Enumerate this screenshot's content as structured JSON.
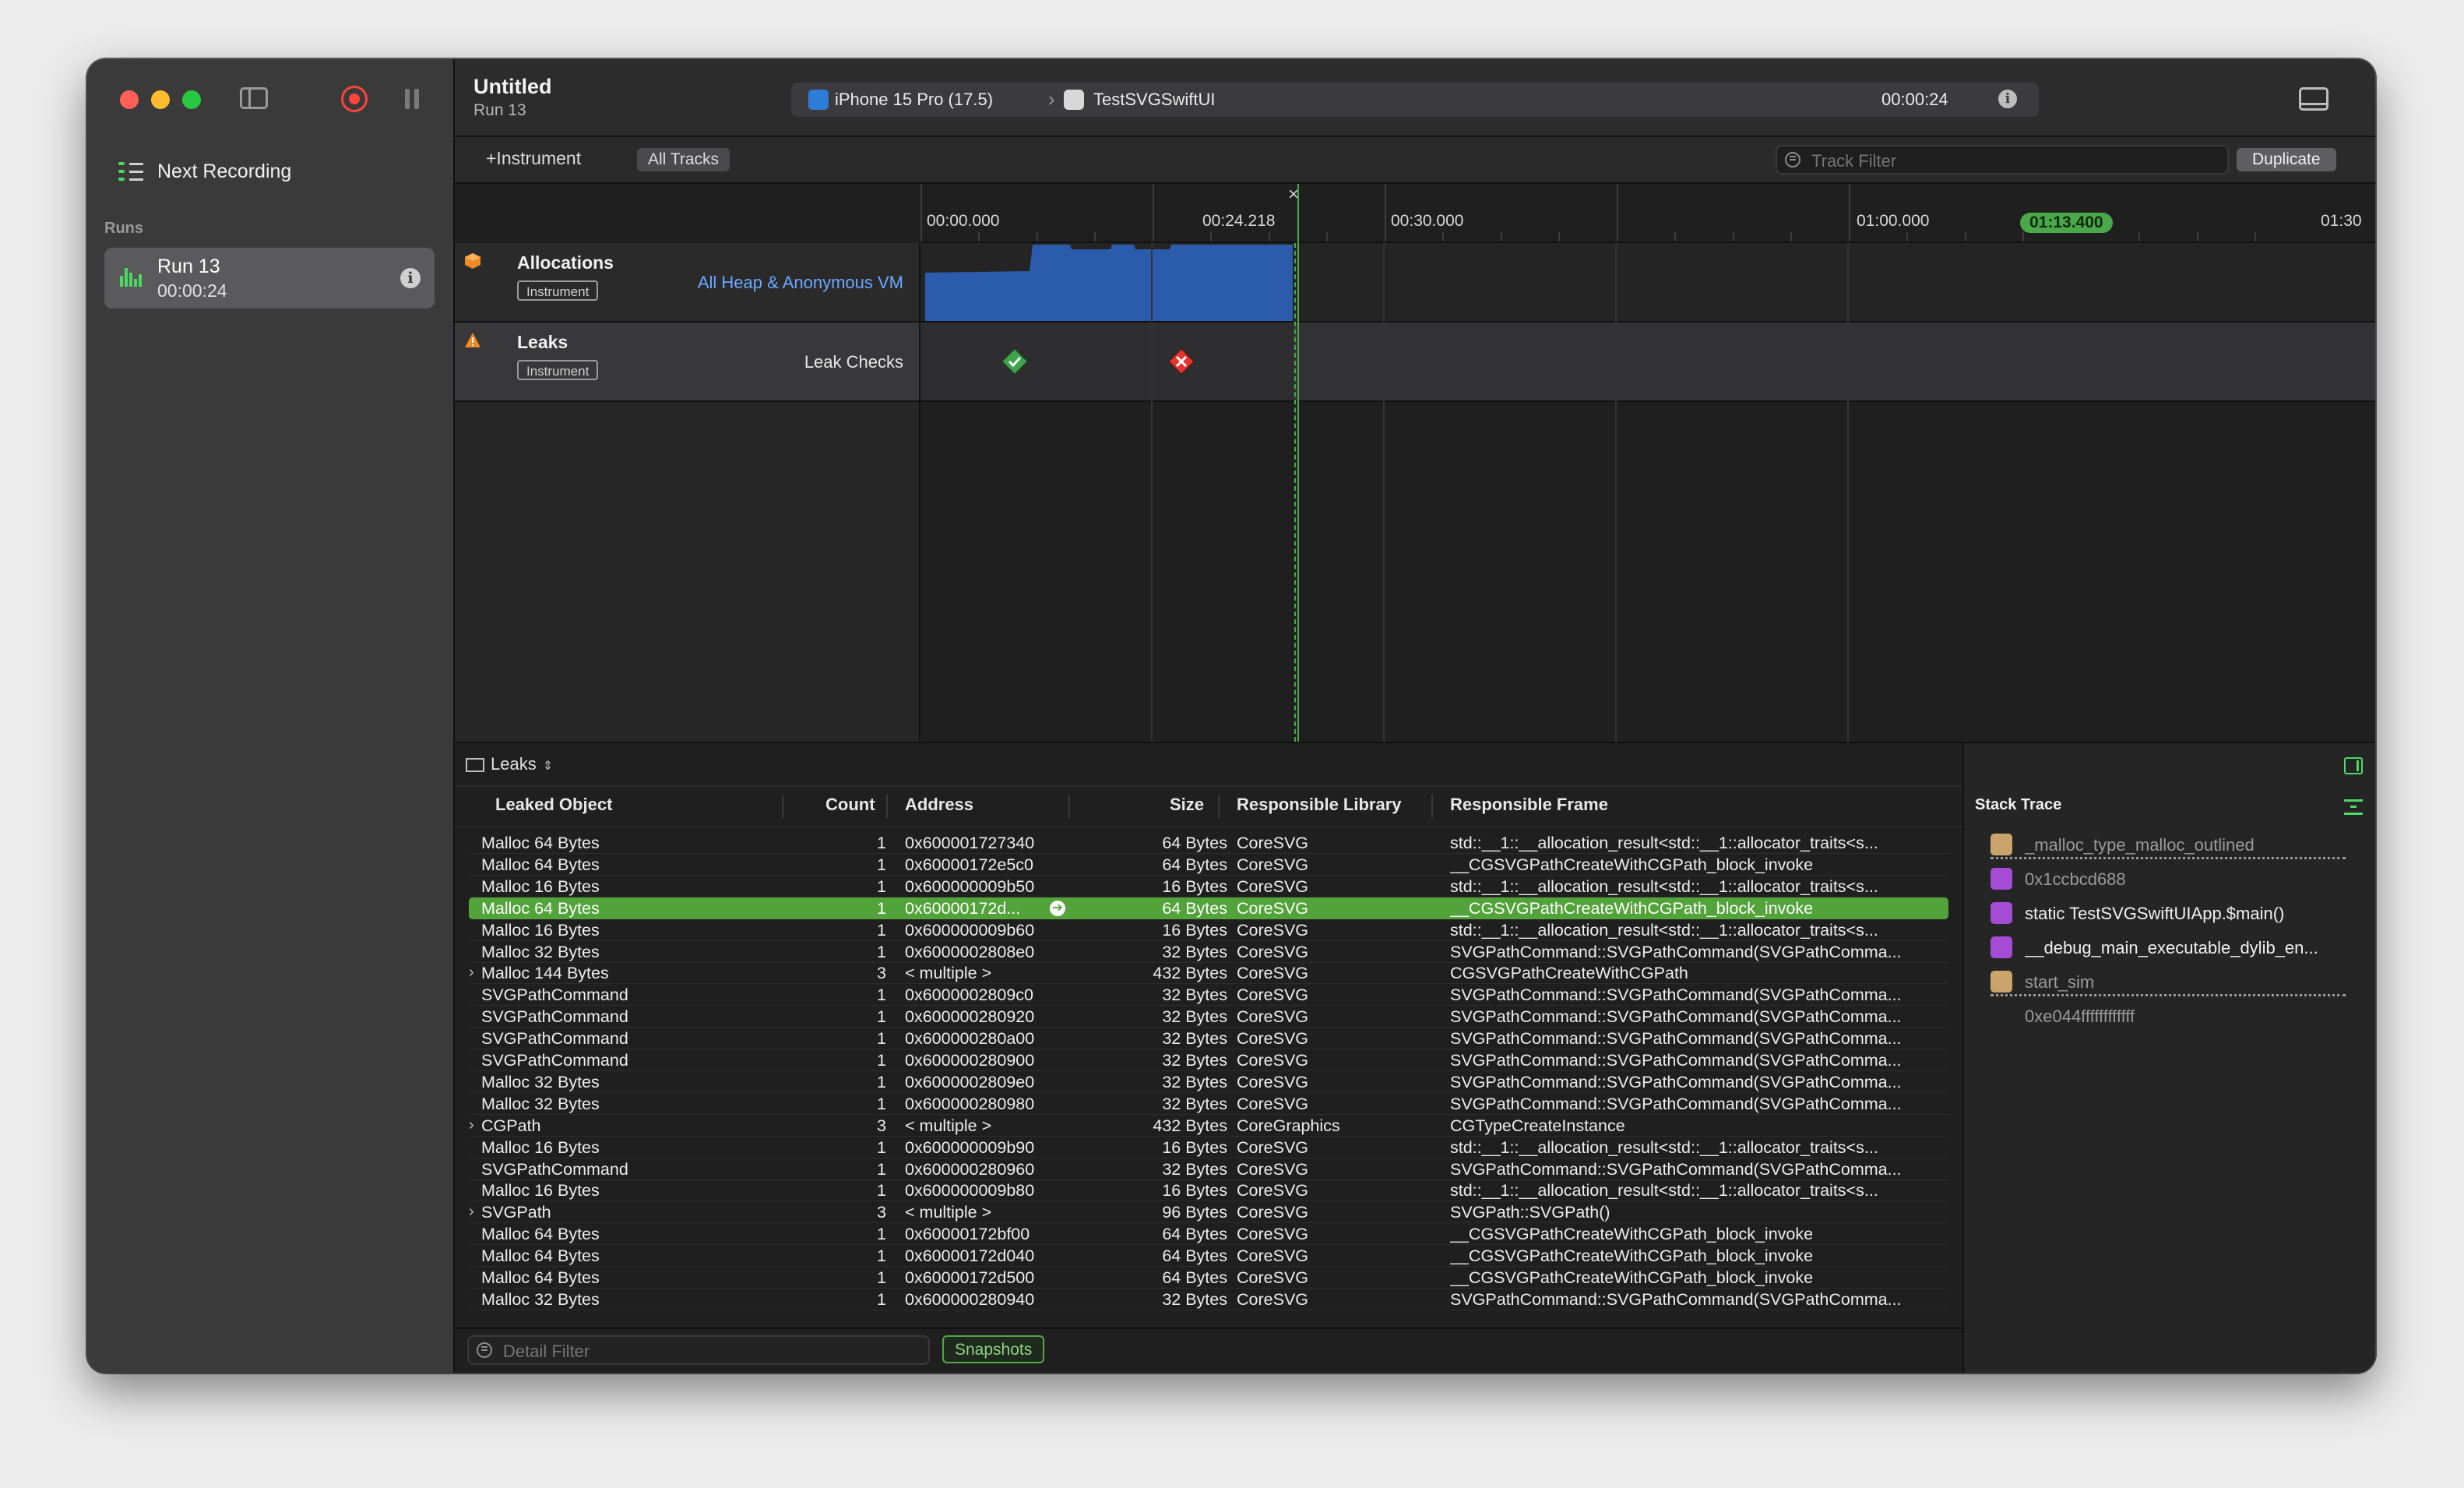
{
  "sidebar": {
    "next_recording": "Next Recording",
    "runs_label": "Runs",
    "run": {
      "name": "Run 13",
      "duration": "00:00:24"
    }
  },
  "titlebar": {
    "title": "Untitled",
    "subtitle": "Run 13",
    "device": "iPhone 15 Pro (17.5)",
    "app": "TestSVGSwiftUI",
    "elapsed": "00:00:24"
  },
  "toolbar": {
    "add_instrument": "+Instrument",
    "all_tracks": "All Tracks",
    "track_filter_placeholder": "Track Filter",
    "duplicate": "Duplicate"
  },
  "timeline": {
    "ticks": [
      {
        "label": "00:00.000"
      },
      {
        "label": "00:24.218"
      },
      {
        "label": "00:30.000"
      },
      {
        "label": "01:00.000"
      },
      {
        "label": "01:30"
      }
    ],
    "marker": "01:13.400",
    "tracks": [
      {
        "name": "Allocations",
        "badge": "Instrument",
        "detail": "All Heap & Anonymous VM"
      },
      {
        "name": "Leaks",
        "badge": "Instrument",
        "detail": "Leak Checks"
      }
    ]
  },
  "detail": {
    "selector": "Leaks",
    "columns": {
      "object": "Leaked Object",
      "count": "Count",
      "address": "Address",
      "size": "Size",
      "library": "Responsible Library",
      "frame": "Responsible Frame"
    },
    "rows": [
      {
        "object": "Malloc 64 Bytes",
        "count": "1",
        "address": "0x600001727340",
        "size": "64 Bytes",
        "library": "CoreSVG",
        "frame": "std::__1::__allocation_result<std::__1::allocator_traits<s..."
      },
      {
        "object": "Malloc 64 Bytes",
        "count": "1",
        "address": "0x60000172e5c0",
        "size": "64 Bytes",
        "library": "CoreSVG",
        "frame": "__CGSVGPathCreateWithCGPath_block_invoke"
      },
      {
        "object": "Malloc 16 Bytes",
        "count": "1",
        "address": "0x600000009b50",
        "size": "16 Bytes",
        "library": "CoreSVG",
        "frame": "std::__1::__allocation_result<std::__1::allocator_traits<s..."
      },
      {
        "object": "Malloc 64 Bytes",
        "count": "1",
        "address": "0x60000172d...",
        "size": "64 Bytes",
        "library": "CoreSVG",
        "frame": "__CGSVGPathCreateWithCGPath_block_invoke",
        "selected": true
      },
      {
        "object": "Malloc 16 Bytes",
        "count": "1",
        "address": "0x600000009b60",
        "size": "16 Bytes",
        "library": "CoreSVG",
        "frame": "std::__1::__allocation_result<std::__1::allocator_traits<s..."
      },
      {
        "object": "Malloc 32 Bytes",
        "count": "1",
        "address": "0x6000002808e0",
        "size": "32 Bytes",
        "library": "CoreSVG",
        "frame": "SVGPathCommand::SVGPathCommand(SVGPathComma..."
      },
      {
        "object": "Malloc 144 Bytes",
        "count": "3",
        "address": "< multiple >",
        "size": "432 Bytes",
        "library": "CoreSVG",
        "frame": "CGSVGPathCreateWithCGPath",
        "expandable": true
      },
      {
        "object": "SVGPathCommand",
        "count": "1",
        "address": "0x6000002809c0",
        "size": "32 Bytes",
        "library": "CoreSVG",
        "frame": "SVGPathCommand::SVGPathCommand(SVGPathComma..."
      },
      {
        "object": "SVGPathCommand",
        "count": "1",
        "address": "0x600000280920",
        "size": "32 Bytes",
        "library": "CoreSVG",
        "frame": "SVGPathCommand::SVGPathCommand(SVGPathComma..."
      },
      {
        "object": "SVGPathCommand",
        "count": "1",
        "address": "0x600000280a00",
        "size": "32 Bytes",
        "library": "CoreSVG",
        "frame": "SVGPathCommand::SVGPathCommand(SVGPathComma..."
      },
      {
        "object": "SVGPathCommand",
        "count": "1",
        "address": "0x600000280900",
        "size": "32 Bytes",
        "library": "CoreSVG",
        "frame": "SVGPathCommand::SVGPathCommand(SVGPathComma..."
      },
      {
        "object": "Malloc 32 Bytes",
        "count": "1",
        "address": "0x6000002809e0",
        "size": "32 Bytes",
        "library": "CoreSVG",
        "frame": "SVGPathCommand::SVGPathCommand(SVGPathComma..."
      },
      {
        "object": "Malloc 32 Bytes",
        "count": "1",
        "address": "0x600000280980",
        "size": "32 Bytes",
        "library": "CoreSVG",
        "frame": "SVGPathCommand::SVGPathCommand(SVGPathComma..."
      },
      {
        "object": "CGPath",
        "count": "3",
        "address": "< multiple >",
        "size": "432 Bytes",
        "library": "CoreGraphics",
        "frame": "CGTypeCreateInstance",
        "expandable": true
      },
      {
        "object": "Malloc 16 Bytes",
        "count": "1",
        "address": "0x600000009b90",
        "size": "16 Bytes",
        "library": "CoreSVG",
        "frame": "std::__1::__allocation_result<std::__1::allocator_traits<s..."
      },
      {
        "object": "SVGPathCommand",
        "count": "1",
        "address": "0x600000280960",
        "size": "32 Bytes",
        "library": "CoreSVG",
        "frame": "SVGPathCommand::SVGPathCommand(SVGPathComma..."
      },
      {
        "object": "Malloc 16 Bytes",
        "count": "1",
        "address": "0x600000009b80",
        "size": "16 Bytes",
        "library": "CoreSVG",
        "frame": "std::__1::__allocation_result<std::__1::allocator_traits<s..."
      },
      {
        "object": "SVGPath",
        "count": "3",
        "address": "< multiple >",
        "size": "96 Bytes",
        "library": "CoreSVG",
        "frame": "SVGPath::SVGPath()",
        "expandable": true
      },
      {
        "object": "Malloc 64 Bytes",
        "count": "1",
        "address": "0x60000172bf00",
        "size": "64 Bytes",
        "library": "CoreSVG",
        "frame": "__CGSVGPathCreateWithCGPath_block_invoke"
      },
      {
        "object": "Malloc 64 Bytes",
        "count": "1",
        "address": "0x60000172d040",
        "size": "64 Bytes",
        "library": "CoreSVG",
        "frame": "__CGSVGPathCreateWithCGPath_block_invoke"
      },
      {
        "object": "Malloc 64 Bytes",
        "count": "1",
        "address": "0x60000172d500",
        "size": "64 Bytes",
        "library": "CoreSVG",
        "frame": "__CGSVGPathCreateWithCGPath_block_invoke"
      },
      {
        "object": "Malloc 32 Bytes",
        "count": "1",
        "address": "0x600000280940",
        "size": "32 Bytes",
        "library": "CoreSVG",
        "frame": "SVGPathCommand::SVGPathCommand(SVGPathComma..."
      }
    ],
    "detail_filter_placeholder": "Detail Filter",
    "snapshots": "Snapshots"
  },
  "stack_trace": {
    "title": "Stack Trace",
    "frames": [
      {
        "text": "_malloc_type_malloc_outlined",
        "kind": "library",
        "dim": true
      },
      {
        "text": "0x1ccbcd688",
        "kind": "user",
        "dim": true
      },
      {
        "text": "static TestSVGSwiftUIApp.$main()",
        "kind": "user",
        "dim": false
      },
      {
        "text": "__debug_main_executable_dylib_en...",
        "kind": "user",
        "dim": false
      },
      {
        "text": "start_sim",
        "kind": "library",
        "dim": true
      },
      {
        "text": "0xe044ffffffffffff",
        "kind": "none",
        "dim": true
      }
    ]
  },
  "colors": {
    "accent_green": "#52a33a",
    "allocation_blue": "#2a5cab",
    "link_blue": "#6aa9ff",
    "leak_ok": "#3fa34d",
    "leak_bad": "#e5342f"
  }
}
